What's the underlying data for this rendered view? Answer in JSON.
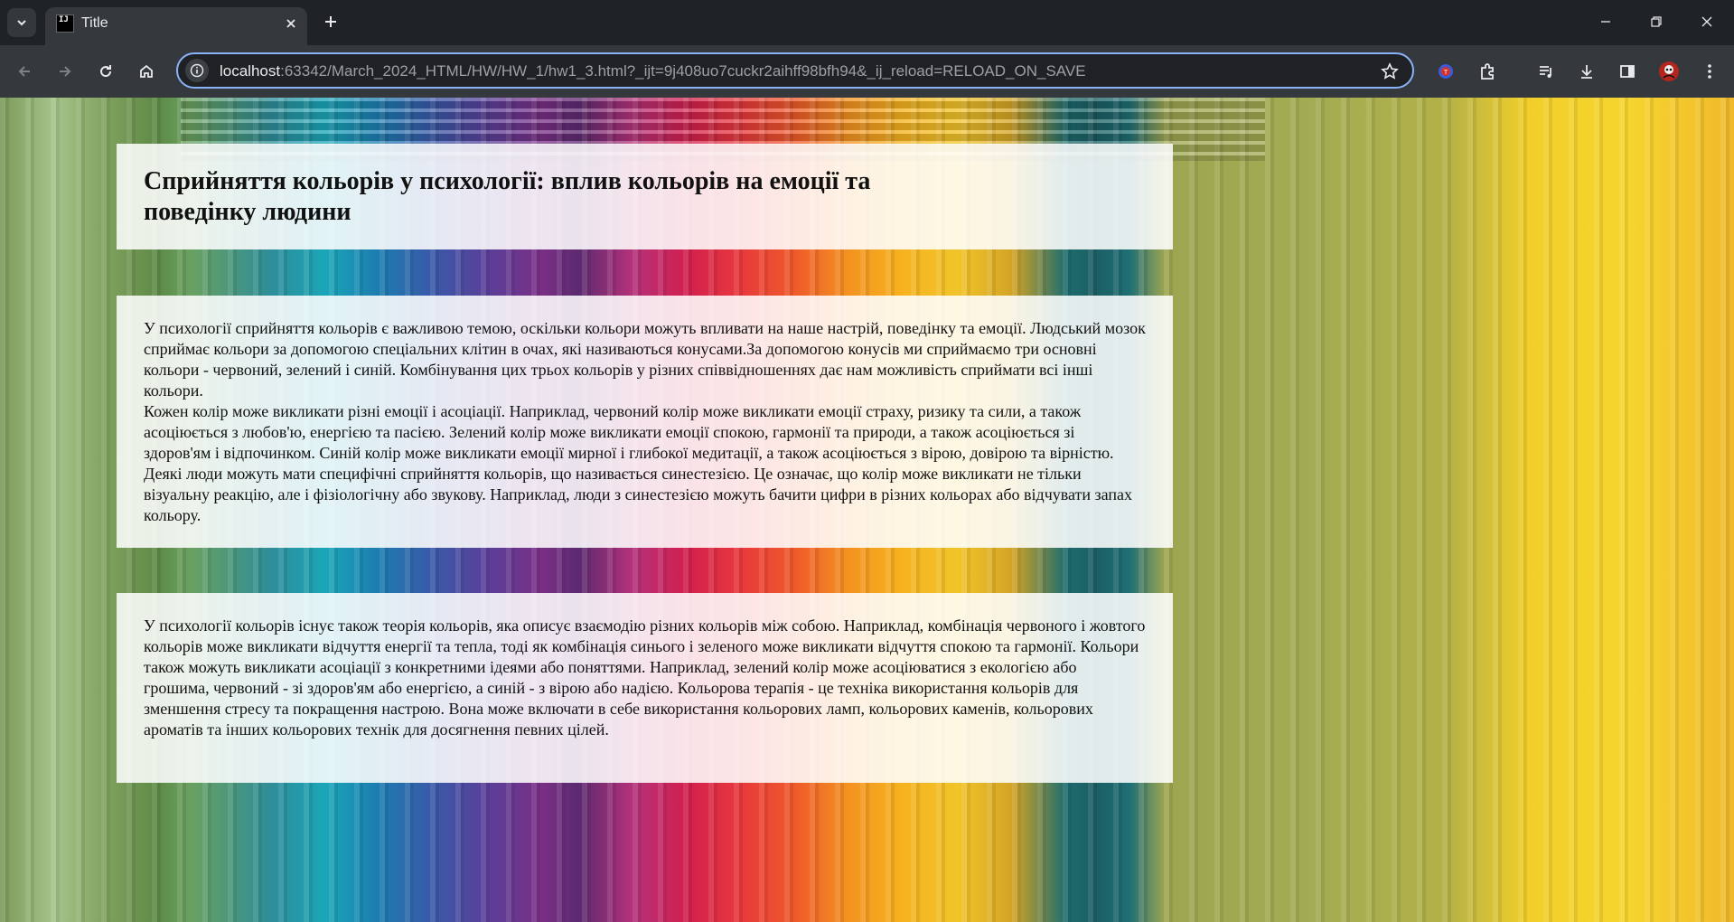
{
  "browser": {
    "tab": {
      "title": "Title",
      "favicon_text": "IJ"
    },
    "address_bar": {
      "host": "localhost",
      "rest": ":63342/March_2024_HTML/HW/HW_1/hw1_3.html?_ijt=9j408uo7cuckr2aihff98bfh94&_ij_reload=RELOAD_ON_SAVE"
    },
    "icons": {
      "tab_search": "chevron-down-icon",
      "close_tab": "close-icon",
      "new_tab": "plus-icon",
      "back": "arrow-left-icon",
      "forward": "arrow-right-icon",
      "reload": "reload-icon",
      "home": "home-icon",
      "site_info": "info-icon",
      "bookmark": "star-icon",
      "extensions": [
        "translate-extension-icon",
        "puzzle-icon",
        "media-control-icon",
        "download-icon",
        "side-panel-icon",
        "profile-avatar-icon",
        "kebab-menu-icon"
      ]
    },
    "colors": {
      "frame": "#1f2327",
      "toolbar": "#35393e",
      "omnibox_border": "#8ab4f8"
    }
  },
  "page": {
    "heading": "Сприйняття кольорів у психології: вплив кольорів на емоції та поведінку людини",
    "paragraph1": "У психології сприйняття кольорів є важливою темою, оскільки кольори можуть впливати на наше настрій, поведінку та емоції. Людський мозок сприймає кольори за допомогою спеціальних клітин в очах, які називаються конусами.За допомогою конусів ми сприймаємо три основні кольори - червоний, зелений і синій. Комбінування цих трьох кольорів у різних співвідношеннях дає нам можливість сприймати всі інші кольори.\nКожен колір може викликати різні емоції і асоціації. Наприклад, червоний колір може викликати емоції страху, ризику та сили, а також асоціюється з любов'ю, енергією та пасією. Зелений колір може викликати емоції спокою, гармонії та природи, а також асоціюється зі здоров'ям і відпочинком. Синій колір може викликати емоції мирної і глибокої медитації, а також асоціюється з вірою, довірою та вірністю. Деякі люди можуть мати специфічні сприйняття кольорів, що називається синестезією. Це означає, що колір може викликати не тільки візуальну реакцію, але і фізіологічну або звукову. Наприклад, люди з синестезією можуть бачити цифри в різних кольорах або відчувати запах кольору.",
    "paragraph2": "У психології кольорів існує також теорія кольорів, яка описує взаємодію різних кольорів між собою. Наприклад, комбінація червоного і жовтого кольорів може викликати відчуття енергії та тепла, тоді як комбінація синього і зеленого може викликати відчуття спокою та гармонії. Кольори також можуть викликати асоціації з конкретними ідеями або поняттями. Наприклад, зелений колір може асоціюватися з екологією або грошима, червоний - зі здоров'ям або енергією, а синій - з вірою або надією. Кольорова терапія - це техніка використання кольорів для зменшення стресу та покращення настрою. Вона може включати в себе використання кольорових ламп, кольорових каменів, кольорових ароматів та інших кольорових технік для досягнення певних цілей."
  }
}
